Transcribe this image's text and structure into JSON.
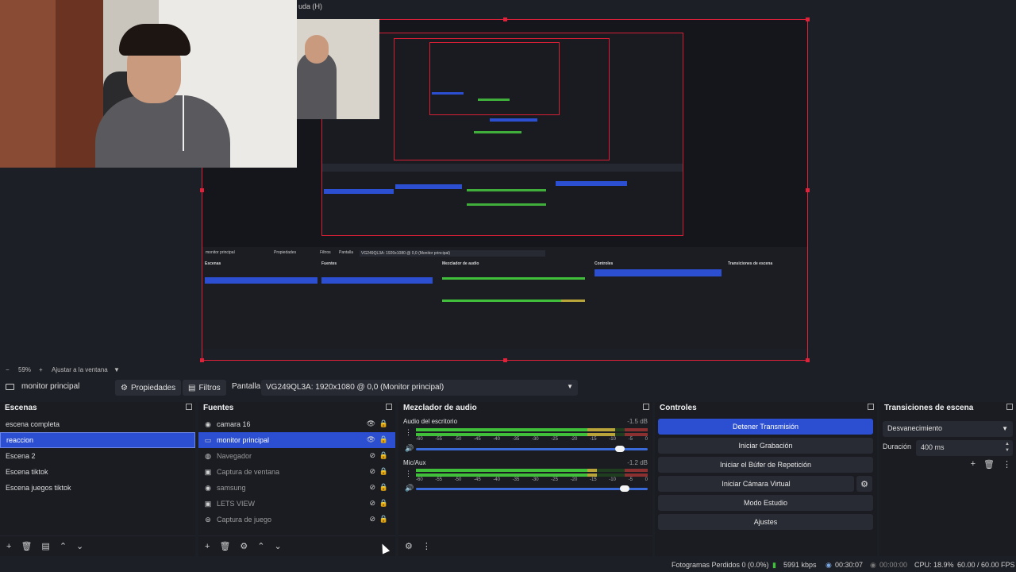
{
  "preview": {
    "menu_fragment": "uda (H)",
    "nested_text": {
      "source_name": "monitor principal",
      "properties": "Propiedades",
      "filters": "Filtros",
      "screen": "Pantalla",
      "display": "VG249QL3A: 1920x1080 @ 0,0 (Monitor principal)",
      "scenes_title": "Escenas",
      "sources_title": "Fuentes",
      "mixer_title": "Mezclador de audio",
      "controls_title": "Controles",
      "transitions_title": "Transiciones de escena"
    }
  },
  "zoom_bar": {
    "minus": "−",
    "zoom": "59%",
    "plus": "+",
    "fit": "Ajustar a la ventana",
    "caret": "▼"
  },
  "source_bar": {
    "selected_source": "monitor principal",
    "properties": "Propiedades",
    "filters": "Filtros",
    "screen_label": "Pantalla",
    "display_value": "VG249QL3A: 1920x1080 @ 0,0 (Monitor principal)"
  },
  "scenes": {
    "title": "Escenas",
    "items": [
      "escena completa",
      "reaccion",
      "Escena 2",
      "Escena tiktok",
      "Escena juegos tiktok"
    ],
    "selected": 1
  },
  "sources": {
    "title": "Fuentes",
    "items": [
      {
        "label": "camara 16",
        "icon": "camera-icon",
        "visible": true
      },
      {
        "label": "monitor principal",
        "icon": "monitor-icon",
        "visible": true
      },
      {
        "label": "Navegador",
        "icon": "globe-icon",
        "visible": false
      },
      {
        "label": "Captura de ventana",
        "icon": "window-icon",
        "visible": false
      },
      {
        "label": "samsung",
        "icon": "camera-icon",
        "visible": false
      },
      {
        "label": "LETS VIEW",
        "icon": "window-icon",
        "visible": false
      },
      {
        "label": "Captura de juego",
        "icon": "gamepad-icon",
        "visible": false
      }
    ],
    "selected": 1
  },
  "mixer": {
    "title": "Mezclador de audio",
    "channels": [
      {
        "name": "Audio del escritorio",
        "db": "-1.5 dB",
        "level": 0.86,
        "volume": 0.9
      },
      {
        "name": "Mic/Aux",
        "db": "-1.2 dB",
        "level": 0.78,
        "volume": 0.92
      }
    ],
    "ticks": [
      "-60",
      "-55",
      "-50",
      "-45",
      "-40",
      "-35",
      "-30",
      "-25",
      "-20",
      "-15",
      "-10",
      "-5",
      "0"
    ]
  },
  "controls": {
    "title": "Controles",
    "stop_stream": "Detener Transmisión",
    "start_recording": "Iniciar Grabación",
    "start_replay": "Iniciar el Búfer de Repetición",
    "start_virtual_cam": "Iniciar Cámara Virtual",
    "studio_mode": "Modo Estudio",
    "settings": "Ajustes"
  },
  "transitions": {
    "title": "Transiciones de escena",
    "selected": "Desvanecimiento",
    "duration_label": "Duración",
    "duration_value": "400 ms"
  },
  "status_bar": {
    "dropped_frames": "Fotogramas Perdidos 0 (0.0%)",
    "bitrate": "5991 kbps",
    "stream_time": "00:30:07",
    "rec_time": "00:00:00",
    "cpu": "CPU: 18.9%",
    "fps": "60.00 / 60.00 FPS"
  },
  "colors": {
    "accent": "#2c4fd1",
    "selection_border": "#e0213a",
    "meter_green": "#3fbf3a",
    "background": "#1d1f26"
  }
}
